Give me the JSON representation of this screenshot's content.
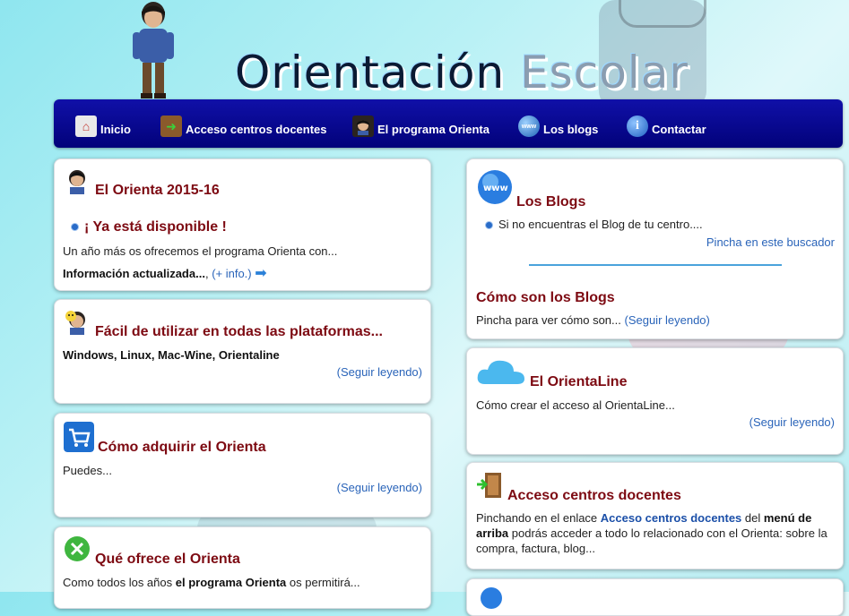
{
  "header": {
    "title_part1": "Orientación",
    "title_part2": "Escolar"
  },
  "nav": [
    {
      "label": "Inicio",
      "icon": "home-icon"
    },
    {
      "label": "Acceso centros docentes",
      "icon": "door-enter-icon"
    },
    {
      "label": "El programa Orienta",
      "icon": "avatar-icon"
    },
    {
      "label": "Los blogs",
      "icon": "globe-www-icon"
    },
    {
      "label": "Contactar",
      "icon": "info-icon"
    }
  ],
  "left": {
    "orienta": {
      "title": "El Orienta 2015-16",
      "headline": "¡ Ya está disponible !",
      "text": "Un año más os ofrecemos el programa Orienta con...",
      "bold": "Información actualizada...",
      "comma": ",",
      "link": "(+ info.)"
    },
    "facil": {
      "title": "Fácil de utilizar en todas las plataformas...",
      "platforms": "Windows, Linux, Mac-Wine, Orientaline",
      "link": "(Seguir leyendo)"
    },
    "adquirir": {
      "title": "Cómo adquirir el Orienta",
      "text": "Puedes...",
      "link": "(Seguir leyendo)"
    },
    "ofrece": {
      "title": "Qué ofrece el Orienta",
      "text_pre": "Como todos los años ",
      "text_bold": "el programa Orienta",
      "text_post": " os permitirá..."
    }
  },
  "right": {
    "blogs": {
      "title": "Los Blogs",
      "item": "Si no encuentras el Blog de tu centro....",
      "link": "Pincha en este buscador",
      "title2": "Cómo son los Blogs",
      "text2": "Pincha para ver cómo son...",
      "link2": "(Seguir leyendo)"
    },
    "orientaline": {
      "title": "El OrientaLine",
      "text": "Cómo crear el acceso al OrientaLine...",
      "link": "(Seguir leyendo)"
    },
    "acceso": {
      "title": "Acceso centros docentes",
      "t1": "Pinchando en el enlace ",
      "t2": "Acceso centros docentes",
      "t3": " del ",
      "t4": "menú de arriba",
      "t5": " podrás acceder a todo lo relacionado con el Orienta: sobre la compra, factura, blog..."
    }
  },
  "colors": {
    "nav_bg": "#02027a",
    "title_red": "#7d0a12",
    "link_blue": "#2a64b9"
  }
}
